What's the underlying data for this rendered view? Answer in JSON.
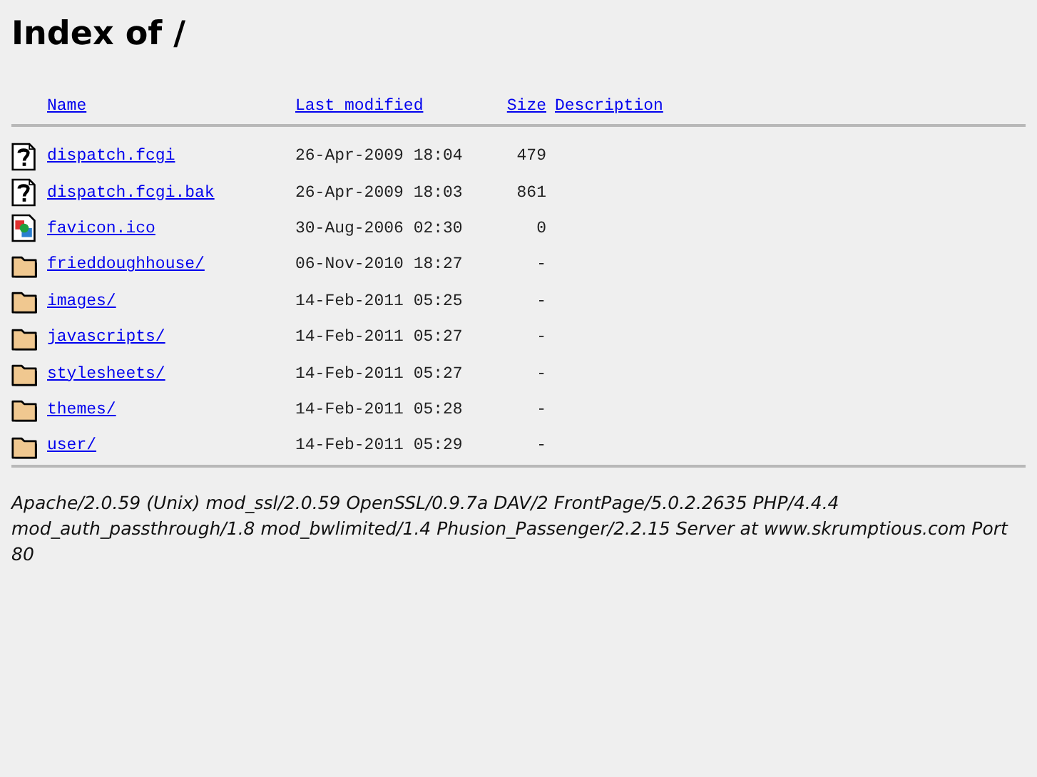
{
  "title": "Index of /",
  "columns": [
    "Name",
    "Last modified",
    "Size",
    "Description"
  ],
  "rows": [
    {
      "kind": "unknown",
      "name": "dispatch.fcgi",
      "modified": "26-Apr-2009 18:04",
      "size": "479"
    },
    {
      "kind": "unknown",
      "name": "dispatch.fcgi.bak",
      "modified": "26-Apr-2009 18:03",
      "size": "861"
    },
    {
      "kind": "image",
      "name": "favicon.ico",
      "modified": "30-Aug-2006 02:30",
      "size": "0"
    },
    {
      "kind": "folder",
      "name": "frieddoughhouse/",
      "modified": "06-Nov-2010 18:27",
      "size": "-"
    },
    {
      "kind": "folder",
      "name": "images/",
      "modified": "14-Feb-2011 05:25",
      "size": "-"
    },
    {
      "kind": "folder",
      "name": "javascripts/",
      "modified": "14-Feb-2011 05:27",
      "size": "-"
    },
    {
      "kind": "folder",
      "name": "stylesheets/",
      "modified": "14-Feb-2011 05:27",
      "size": "-"
    },
    {
      "kind": "folder",
      "name": "themes/",
      "modified": "14-Feb-2011 05:28",
      "size": "-"
    },
    {
      "kind": "folder",
      "name": "user/",
      "modified": "14-Feb-2011 05:29",
      "size": "-"
    }
  ],
  "server_signature": "Apache/2.0.59 (Unix) mod_ssl/2.0.59 OpenSSL/0.9.7a DAV/2 FrontPage/5.0.2.2635 PHP/4.4.4 mod_auth_passthrough/1.8 mod_bwlimited/1.4 Phusion_Passenger/2.2.15 Server at www.skrumptious.com Port 80"
}
